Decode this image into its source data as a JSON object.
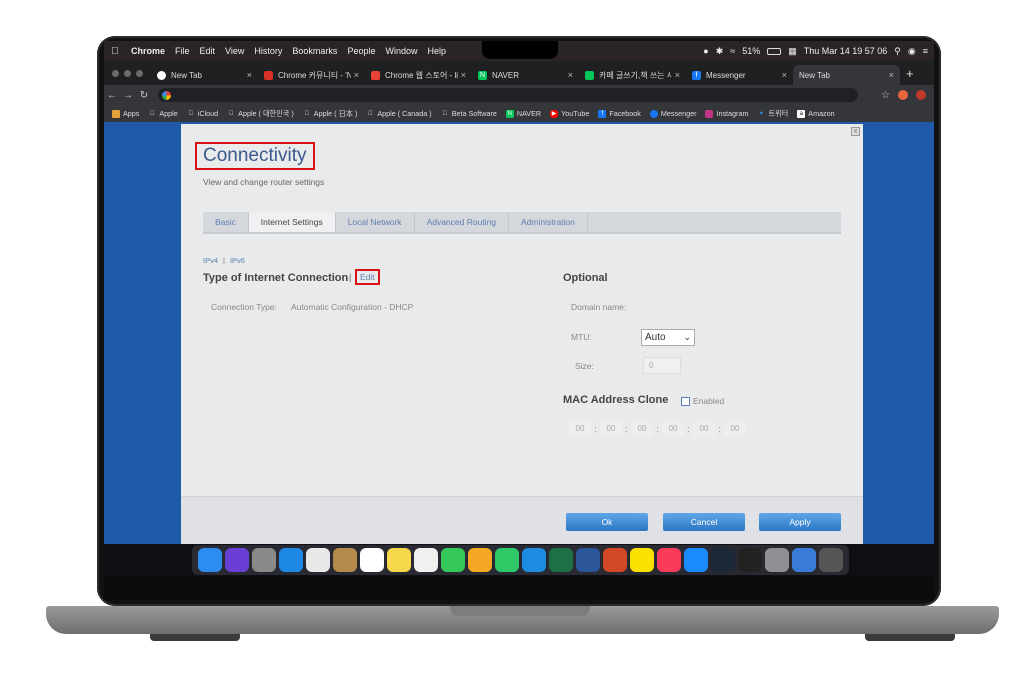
{
  "menubar": {
    "apple_icon": "apple-icon",
    "items": [
      "Chrome",
      "File",
      "Edit",
      "View",
      "History",
      "Bookmarks",
      "People",
      "Window",
      "Help"
    ],
    "battery": "51%",
    "datetime": "Thu Mar 14  19 57 06"
  },
  "browser": {
    "tabs": [
      {
        "title": "New Tab",
        "color": "#4285f4"
      },
      {
        "title": "Chrome 커뮤니티 - 'N...",
        "color": "#d93025"
      },
      {
        "title": "Chrome 웹 스토어 - li...",
        "color": "#ea4335"
      },
      {
        "title": "NAVER",
        "color": "#03c75a"
      },
      {
        "title": "카페 글쓰기,책 쓰는 사람...",
        "color": "#03c75a"
      },
      {
        "title": "Messenger",
        "color": "#1877f2"
      },
      {
        "title": "New Tab",
        "color": "#35363a"
      }
    ],
    "new_tab_symbol": "+",
    "close_symbol": "×"
  },
  "bookmarks": [
    {
      "label": "Apps",
      "color": "#888"
    },
    {
      "label": "Apple",
      "color": "#666"
    },
    {
      "label": "iCloud",
      "color": "#666"
    },
    {
      "label": "Apple ( 대한민국 )",
      "color": "#666"
    },
    {
      "label": "Apple ( 日本 )",
      "color": "#666"
    },
    {
      "label": "Apple ( Canada )",
      "color": "#666"
    },
    {
      "label": "Beta Software",
      "color": "#666"
    },
    {
      "label": "NAVER",
      "color": "#03c75a"
    },
    {
      "label": "YouTube",
      "color": "#ff0000"
    },
    {
      "label": "Facebook",
      "color": "#1877f2"
    },
    {
      "label": "Messenger",
      "color": "#1877f2"
    },
    {
      "label": "Instagram",
      "color": "#c13584"
    },
    {
      "label": "트위터",
      "color": "#1da1f2"
    },
    {
      "label": "Amazon",
      "color": "#222"
    }
  ],
  "router": {
    "title": "Connectivity",
    "subtitle": "View and change router settings",
    "tabs": [
      "Basic",
      "Internet Settings",
      "Local Network",
      "Advanced Routing",
      "Administration"
    ],
    "active_tab": "Internet Settings",
    "ip_links": {
      "ipv4": "IPv4",
      "sep": "|",
      "ipv6": "IPv6"
    },
    "section_connection": "Type of Internet Connection",
    "bar_sep": "|",
    "edit_label": "Edit",
    "connection_type_label": "Connection Type:",
    "connection_type_value": "Automatic Configuration - DHCP",
    "optional_title": "Optional",
    "domain_name_label": "Domain name:",
    "mtu_label": "MTU:",
    "mtu_value": "Auto",
    "size_label": "Size:",
    "size_value": "0",
    "mac_clone_title": "MAC Address Clone",
    "enabled_label": "Enabled",
    "mac_octets": [
      "00",
      "00",
      "00",
      "00",
      "00",
      "00"
    ],
    "buttons": {
      "ok": "Ok",
      "cancel": "Cancel",
      "apply": "Apply"
    }
  },
  "dock": {
    "apps": [
      {
        "name": "finder",
        "color": "#2d8cf0"
      },
      {
        "name": "siri",
        "color": "#6a3fd6"
      },
      {
        "name": "launchpad",
        "color": "#8a8a8a"
      },
      {
        "name": "safari",
        "color": "#1e88e5"
      },
      {
        "name": "chrome",
        "color": "#e8e8e8"
      },
      {
        "name": "contacts",
        "color": "#b58b4c"
      },
      {
        "name": "calendar",
        "color": "#ffffff"
      },
      {
        "name": "notes",
        "color": "#f7d84b"
      },
      {
        "name": "photos",
        "color": "#f0f0f0"
      },
      {
        "name": "messages",
        "color": "#34c759"
      },
      {
        "name": "pages",
        "color": "#f5a623"
      },
      {
        "name": "numbers",
        "color": "#2ec866"
      },
      {
        "name": "keynote",
        "color": "#1d8ce0"
      },
      {
        "name": "excel",
        "color": "#1d7044"
      },
      {
        "name": "word",
        "color": "#2b579a"
      },
      {
        "name": "powerpoint",
        "color": "#d24726"
      },
      {
        "name": "kakaotalk",
        "color": "#fae100"
      },
      {
        "name": "music",
        "color": "#fa3c5a"
      },
      {
        "name": "app-store",
        "color": "#1a8cff"
      },
      {
        "name": "steam",
        "color": "#1b2838"
      },
      {
        "name": "vectorworks",
        "color": "#222"
      },
      {
        "name": "system-preferences",
        "color": "#8e8e93"
      },
      {
        "name": "preview",
        "color": "#3a7bd5"
      },
      {
        "name": "trash",
        "color": "#555"
      }
    ]
  }
}
